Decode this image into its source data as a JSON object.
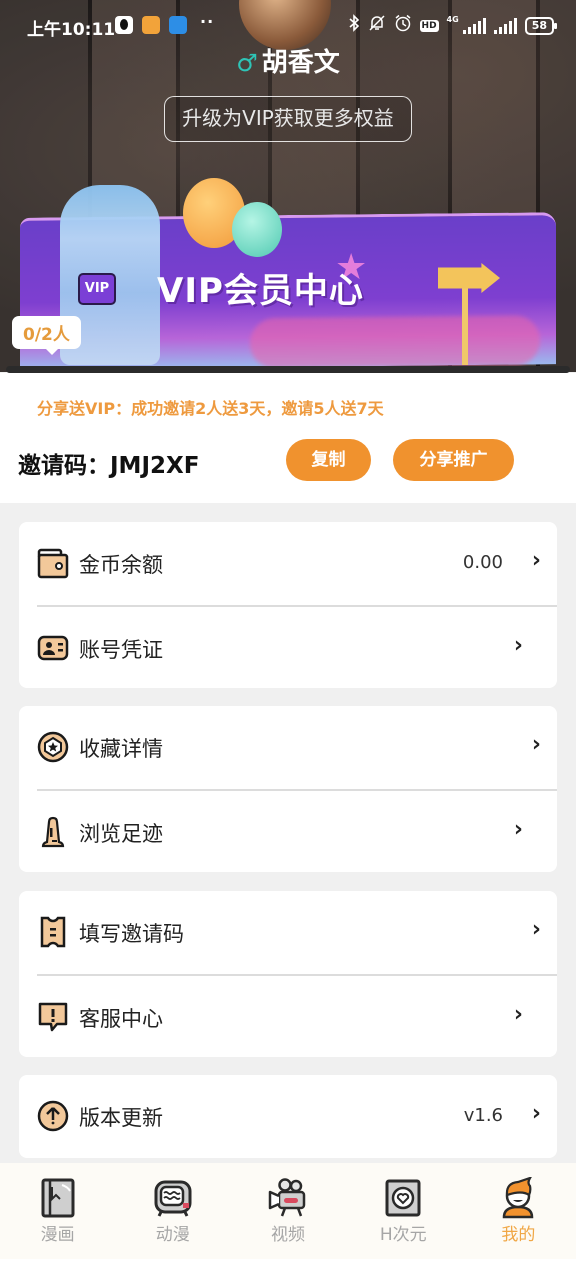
{
  "status_bar": {
    "time": "上午10:11",
    "app_icons": [
      "qq-icon",
      "orange-app-icon",
      "blue-app-icon"
    ],
    "more": "··",
    "right_icons": [
      "bluetooth-icon",
      "mute-icon",
      "alarm-icon",
      "hd-icon",
      "signal-4g-icon",
      "signal-icon",
      "battery-icon"
    ],
    "hd_label": "HD",
    "network_label": "4G",
    "battery": "58"
  },
  "profile": {
    "gender_symbol": "♂",
    "name": "胡香文",
    "vip_upgrade_label": "升级为VIP获取更多权益"
  },
  "vip_banner": {
    "title": "VIP会员中心",
    "badge": "VIP",
    "invite_progress_label": "0/2人",
    "invite_progress_fraction": 0.0
  },
  "invite": {
    "hint": "分享送VIP：成功邀请2人送3天，邀请5人送7天",
    "code_label": "邀请码：",
    "code": "JMJ2XF",
    "copy_label": "复制",
    "share_label": "分享推广"
  },
  "menu_groups": [
    [
      {
        "icon": "wallet-icon",
        "label": "金币余额",
        "value": "0.00"
      },
      {
        "icon": "id-card-icon",
        "label": "账号凭证",
        "value": ""
      }
    ],
    [
      {
        "icon": "favorite-star-icon",
        "label": "收藏详情",
        "value": ""
      },
      {
        "icon": "history-icon",
        "label": "浏览足迹",
        "value": ""
      }
    ],
    [
      {
        "icon": "ticket-icon",
        "label": "填写邀请码",
        "value": ""
      },
      {
        "icon": "support-icon",
        "label": "客服中心",
        "value": ""
      }
    ],
    [
      {
        "icon": "update-icon",
        "label": "版本更新",
        "value": "v1.6"
      }
    ]
  ],
  "chevron": "›",
  "bottom_nav": [
    {
      "icon": "comic-book-icon",
      "label": "漫画",
      "active": false
    },
    {
      "icon": "tv-icon",
      "label": "动漫",
      "active": false
    },
    {
      "icon": "video-camera-icon",
      "label": "视频",
      "active": false
    },
    {
      "icon": "h-dimension-icon",
      "label": "H次元",
      "active": false
    },
    {
      "icon": "profile-avatar-icon",
      "label": "我的",
      "active": true
    }
  ],
  "colors": {
    "accent": "#f0922e",
    "hint_text": "#ee9a3f",
    "nav_active": "#f0a746",
    "nav_inactive": "#a6a6a6",
    "gender": "#2ec4b6",
    "vip_purple": "#7e3fd0"
  }
}
